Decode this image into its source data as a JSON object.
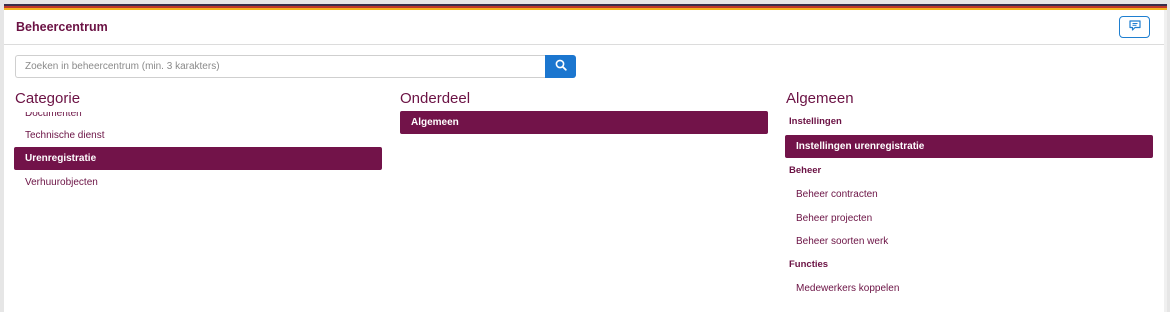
{
  "header": {
    "title": "Beheercentrum",
    "feedback_icon": "message-icon"
  },
  "search": {
    "placeholder": "Zoeken in beheercentrum (min. 3 karakters)",
    "value": "",
    "button_icon": "search-icon"
  },
  "categorie": {
    "title": "Categorie",
    "items": [
      {
        "label": "Documenten",
        "active": false
      },
      {
        "label": "Technische dienst",
        "active": false
      },
      {
        "label": "Urenregistratie",
        "active": true
      },
      {
        "label": "Verhuurobjecten",
        "active": false
      }
    ]
  },
  "onderdeel": {
    "title": "Onderdeel",
    "items": [
      {
        "label": "Algemeen",
        "active": true
      }
    ]
  },
  "algemeen": {
    "title": "Algemeen",
    "groups": [
      {
        "header": "Instellingen",
        "items": [
          {
            "label": "Instellingen urenregistratie",
            "active": true
          }
        ]
      },
      {
        "header": "Beheer",
        "items": [
          {
            "label": "Beheer contracten",
            "active": false
          },
          {
            "label": "Beheer projecten",
            "active": false
          },
          {
            "label": "Beheer soorten werk",
            "active": false
          }
        ]
      },
      {
        "header": "Functies",
        "items": [
          {
            "label": "Medewerkers koppelen",
            "active": false
          }
        ]
      }
    ]
  },
  "colors": {
    "accent": "#721349",
    "button_blue": "#1b76cf"
  }
}
